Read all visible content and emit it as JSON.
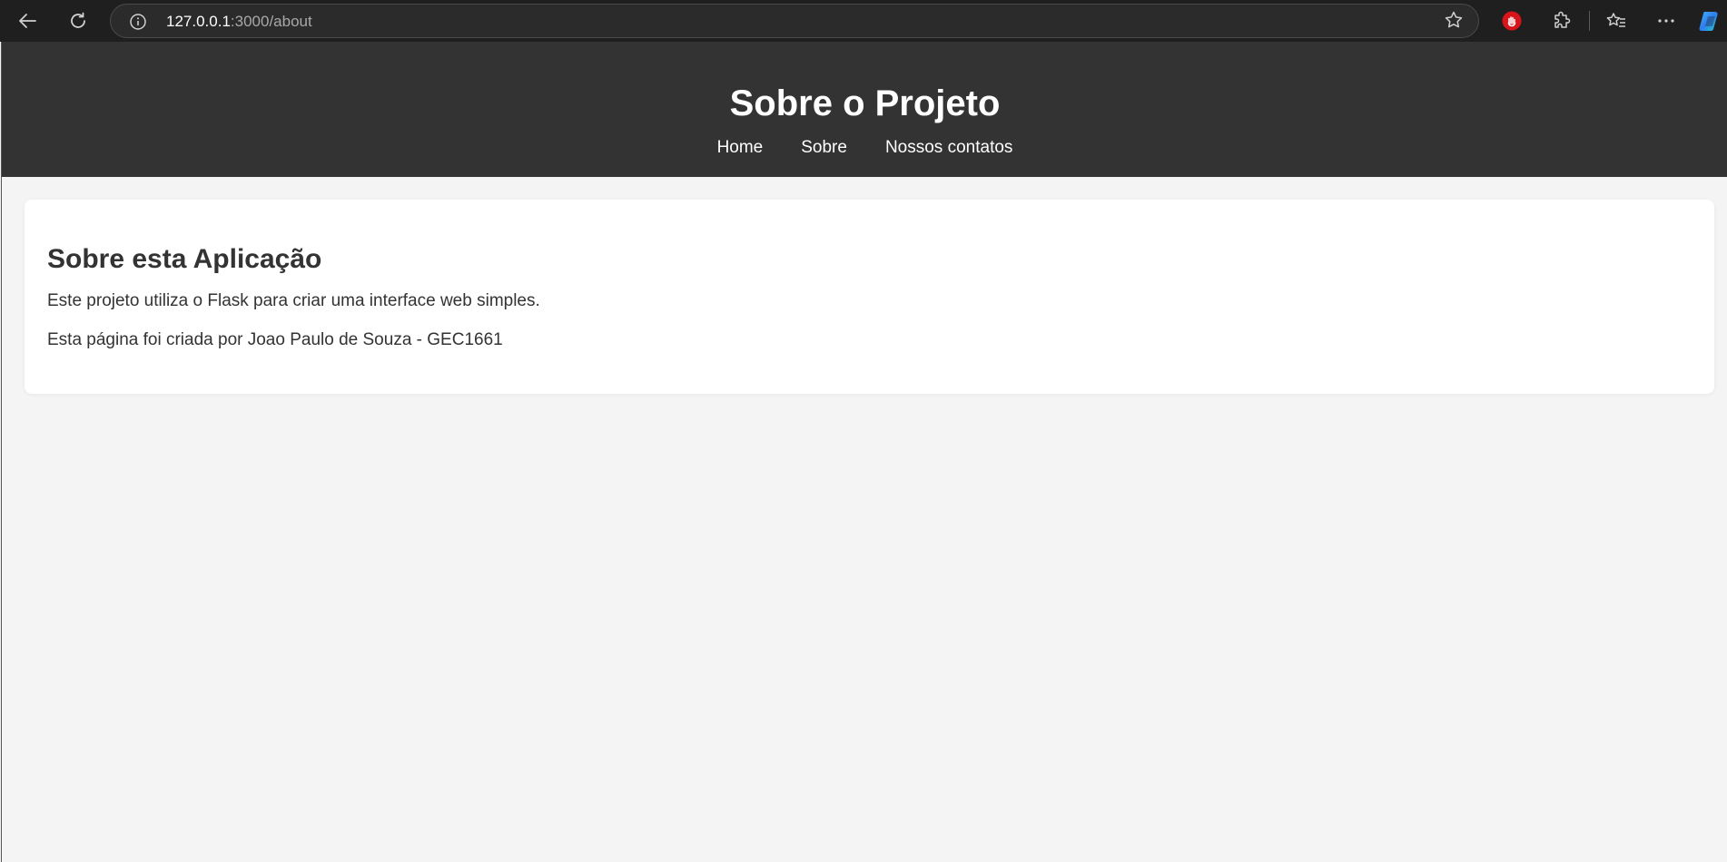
{
  "browser": {
    "url_host": "127.0.0.1",
    "url_path": ":3000/about",
    "icons": [
      "back-arrow-icon",
      "refresh-icon",
      "info-icon",
      "favorite-star-icon",
      "extension-blocker-icon",
      "extensions-puzzle-icon",
      "favorites-list-icon",
      "more-menu-icon",
      "copilot-icon"
    ],
    "colors": {
      "chrome_bg": "#1f1f1f",
      "address_bg": "#2b2b2b",
      "blocker_red": "#d9141b"
    }
  },
  "header": {
    "title": "Sobre o Projeto",
    "nav": [
      {
        "label": "Home"
      },
      {
        "label": "Sobre"
      },
      {
        "label": "Nossos contatos"
      }
    ],
    "bg_color": "#333333"
  },
  "main": {
    "heading": "Sobre esta Aplicação",
    "paragraphs": [
      "Este projeto utiliza o Flask para criar uma interface web simples.",
      "Esta página foi criada por Joao Paulo de Souza - GEC1661"
    ],
    "page_bg": "#f4f4f4",
    "card_bg": "#ffffff"
  }
}
